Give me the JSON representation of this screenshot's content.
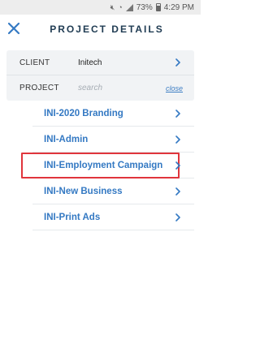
{
  "status_bar": {
    "battery": "73%",
    "time": "4:29 PM",
    "icons": [
      "mute-icon",
      "wifi-icon",
      "signal-icon",
      "battery-icon"
    ]
  },
  "header": {
    "title": "PROJECT DETAILS",
    "close_icon": "close-icon"
  },
  "filters": {
    "client_label": "CLIENT",
    "client_value": "Initech",
    "project_label": "PROJECT",
    "search_placeholder": "search",
    "close_label": "close"
  },
  "projects": [
    {
      "label": "INI-2020 Branding",
      "highlighted": false
    },
    {
      "label": "INI-Admin",
      "highlighted": false
    },
    {
      "label": "INI-Employment Campaign",
      "highlighted": true
    },
    {
      "label": "INI-New Business",
      "highlighted": false
    },
    {
      "label": "INI-Print Ads",
      "highlighted": false
    }
  ],
  "colors": {
    "accent": "#3479c3",
    "title": "#1f3b52",
    "highlight_border": "#e0353c",
    "panel_bg": "#f1f3f5"
  }
}
